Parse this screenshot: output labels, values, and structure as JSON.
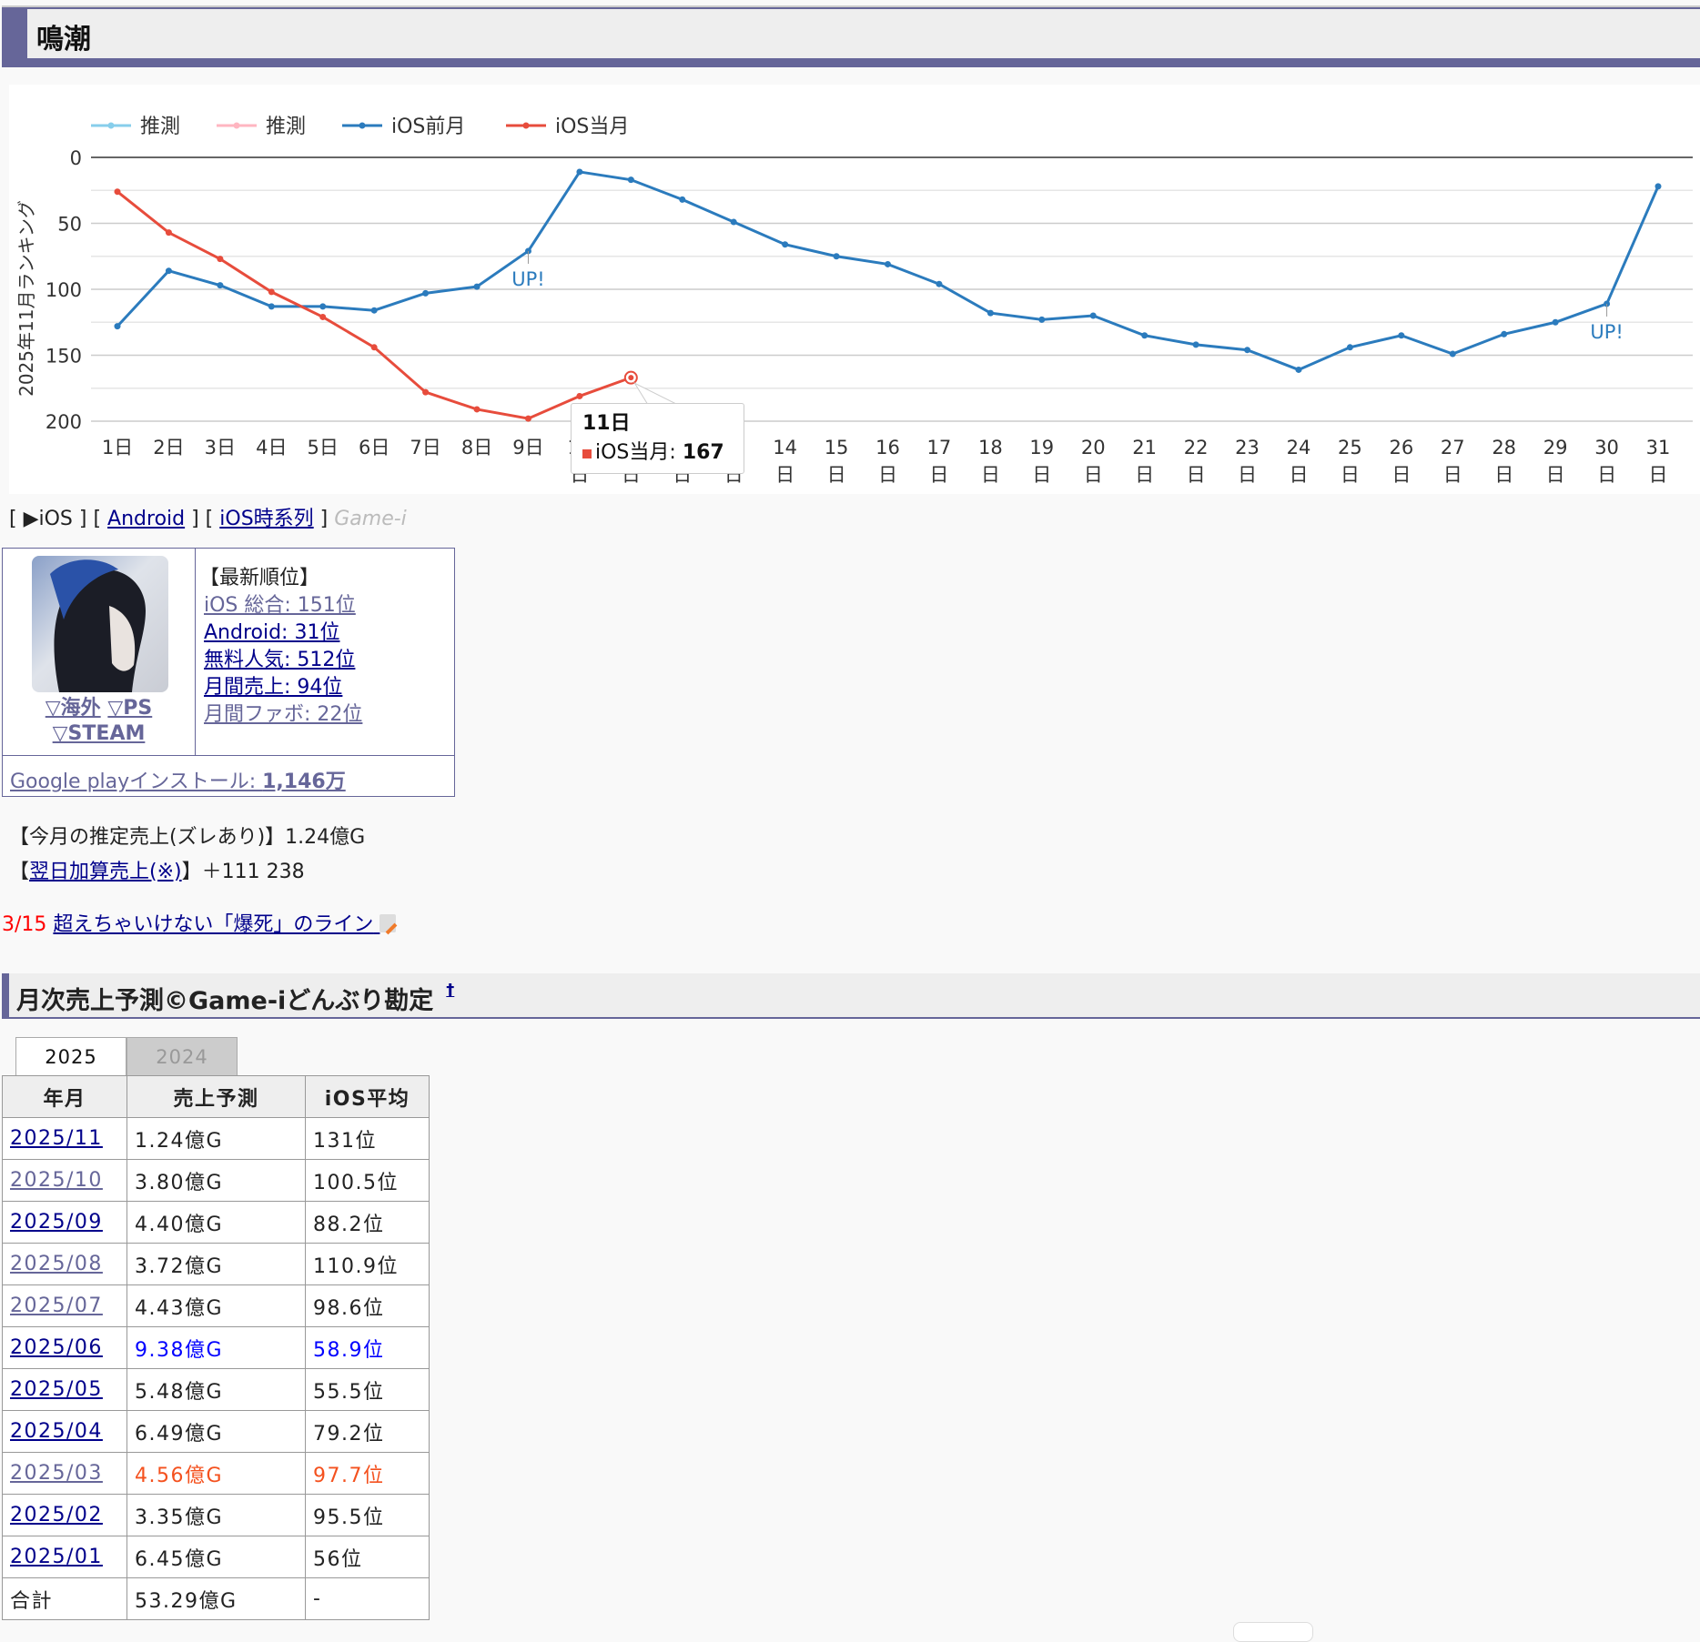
{
  "header": {
    "title": "鳴潮"
  },
  "chart_data": {
    "type": "line",
    "ylabel": "2025年11月ランキング",
    "ylim": [
      0,
      200
    ],
    "y_reversed": true,
    "y_ticks": [
      "0",
      "50",
      "100",
      "150",
      "200"
    ],
    "grid": true,
    "legend_position": "top-left",
    "categories": [
      "1日",
      "2日",
      "3日",
      "4日",
      "5日",
      "6日",
      "7日",
      "8日",
      "9日",
      "10日",
      "11日",
      "12日",
      "13日",
      "14日",
      "15日",
      "16日",
      "17日",
      "18日",
      "19日",
      "20日",
      "21日",
      "22日",
      "23日",
      "24日",
      "25日",
      "26日",
      "27日",
      "28日",
      "29日",
      "30日",
      "31日"
    ],
    "series": [
      {
        "name": "推測",
        "color": "#87ceeb",
        "values": []
      },
      {
        "name": "推測",
        "color": "#ffb6c1",
        "values": []
      },
      {
        "name": "iOS前月",
        "color": "#2b7bbd",
        "values": [
          128,
          86,
          97,
          113,
          113,
          116,
          103,
          98,
          71,
          11,
          17,
          32,
          49,
          66,
          75,
          81,
          96,
          118,
          123,
          120,
          135,
          142,
          146,
          161,
          144,
          135,
          149,
          134,
          125,
          111,
          22
        ]
      },
      {
        "name": "iOS当月",
        "color": "#e74c3c",
        "values": [
          26,
          57,
          77,
          102,
          121,
          144,
          178,
          191,
          198,
          181,
          167,
          null,
          null,
          null,
          null,
          null,
          null,
          null,
          null,
          null,
          null,
          null,
          null,
          null,
          null,
          null,
          null,
          null,
          null,
          null,
          null
        ]
      }
    ],
    "annotations": [
      {
        "series": "iOS前月",
        "category": "9日",
        "text": "UP!"
      },
      {
        "series": "iOS前月",
        "category": "30日",
        "text": "UP!"
      }
    ],
    "tooltip": {
      "title": "11日",
      "series": "iOS当月",
      "value": "167"
    }
  },
  "nav": {
    "open": "[ ",
    "ios": "▶iOS",
    "sep1": " ] [ ",
    "android": "Android",
    "sep2": " ] [ ",
    "timeseries": "iOS時系列",
    "close": " ] ",
    "brand": "Game-i"
  },
  "info": {
    "links": [
      "▽海外",
      "▽PS",
      "▽STEAM"
    ],
    "latest_heading": "【最新順位】",
    "ranks": [
      "iOS 総合: 151位",
      "Android: 31位",
      "無料人気: 512位",
      "月間売上: 94位",
      "月間ファボ: 22位"
    ],
    "install_label": "Google playインストール: ",
    "install_value": "1,146万"
  },
  "estimate": {
    "label": "【今月の推定売上(ズレあり)】",
    "value": "1.24億G"
  },
  "nextday": {
    "open": "【",
    "link": "翌日加算売上(※)",
    "close": "】",
    "value": "＋111 238"
  },
  "news": {
    "date": "3/15",
    "link": "超えちゃいけない「爆死」のライン"
  },
  "section2": {
    "title": "月次売上予測©Game-iどんぶり勘定",
    "up": "†"
  },
  "tabs": [
    "2025",
    "2024"
  ],
  "table": {
    "headers": [
      "年月",
      "売上予測",
      "iOS平均"
    ],
    "rows": [
      [
        "2025/11",
        "1.24億G",
        "131位"
      ],
      [
        "2025/10",
        "3.80億G",
        "100.5位"
      ],
      [
        "2025/09",
        "4.40億G",
        "88.2位"
      ],
      [
        "2025/08",
        "3.72億G",
        "110.9位"
      ],
      [
        "2025/07",
        "4.43億G",
        "98.6位"
      ],
      [
        "2025/06",
        "9.38億G",
        "58.9位"
      ],
      [
        "2025/05",
        "5.48億G",
        "55.5位"
      ],
      [
        "2025/04",
        "6.49億G",
        "79.2位"
      ],
      [
        "2025/03",
        "4.56億G",
        "97.7位"
      ],
      [
        "2025/02",
        "3.35億G",
        "95.5位"
      ],
      [
        "2025/01",
        "6.45億G",
        "56位"
      ]
    ],
    "total": [
      "合計",
      "53.29億G",
      "-"
    ],
    "highlight_colors": {
      "2025/06": "#0000ff",
      "2025/03": "#f4511e"
    }
  }
}
